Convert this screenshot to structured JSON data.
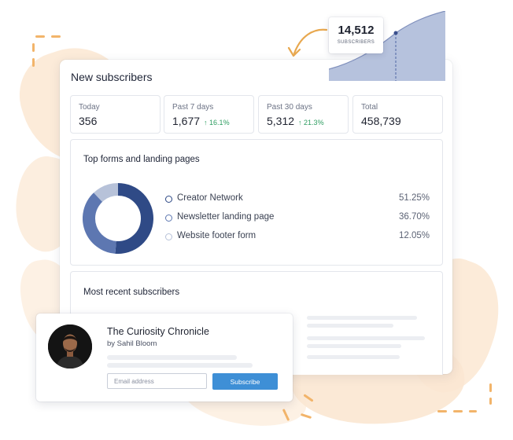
{
  "header": {
    "title": "New subscribers"
  },
  "stats": [
    {
      "label": "Today",
      "value": "356",
      "delta": ""
    },
    {
      "label": "Past 7 days",
      "value": "1,677",
      "delta": "↑ 16.1%"
    },
    {
      "label": "Past 30 days",
      "value": "5,312",
      "delta": "↑ 21.3%"
    },
    {
      "label": "Total",
      "value": "458,739",
      "delta": ""
    }
  ],
  "top_forms": {
    "title": "Top forms and landing pages",
    "items": [
      {
        "name": "Creator Network",
        "percent": "51.25%",
        "color": "#2f4a86"
      },
      {
        "name": "Newsletter landing page",
        "percent": "36.70%",
        "color": "#5d77b1"
      },
      {
        "name": "Website footer form",
        "percent": "12.05%",
        "color": "#b7c2d9"
      }
    ]
  },
  "recent": {
    "title": "Most recent subscribers"
  },
  "chart": {
    "value": "14,512",
    "label": "SUBSCRIBERS",
    "fill": "#b6c2dd",
    "line": "#7f8fbc"
  },
  "form": {
    "title": "The Curiosity Chronicle",
    "author": "by Sahil Bloom",
    "email_placeholder": "Email address",
    "button_label": "Subscribe"
  },
  "colors": {
    "accent": "#3e8fd6",
    "positive": "#2f9e62",
    "brush": "#fbe7d2",
    "dash": "#f2b46a"
  }
}
